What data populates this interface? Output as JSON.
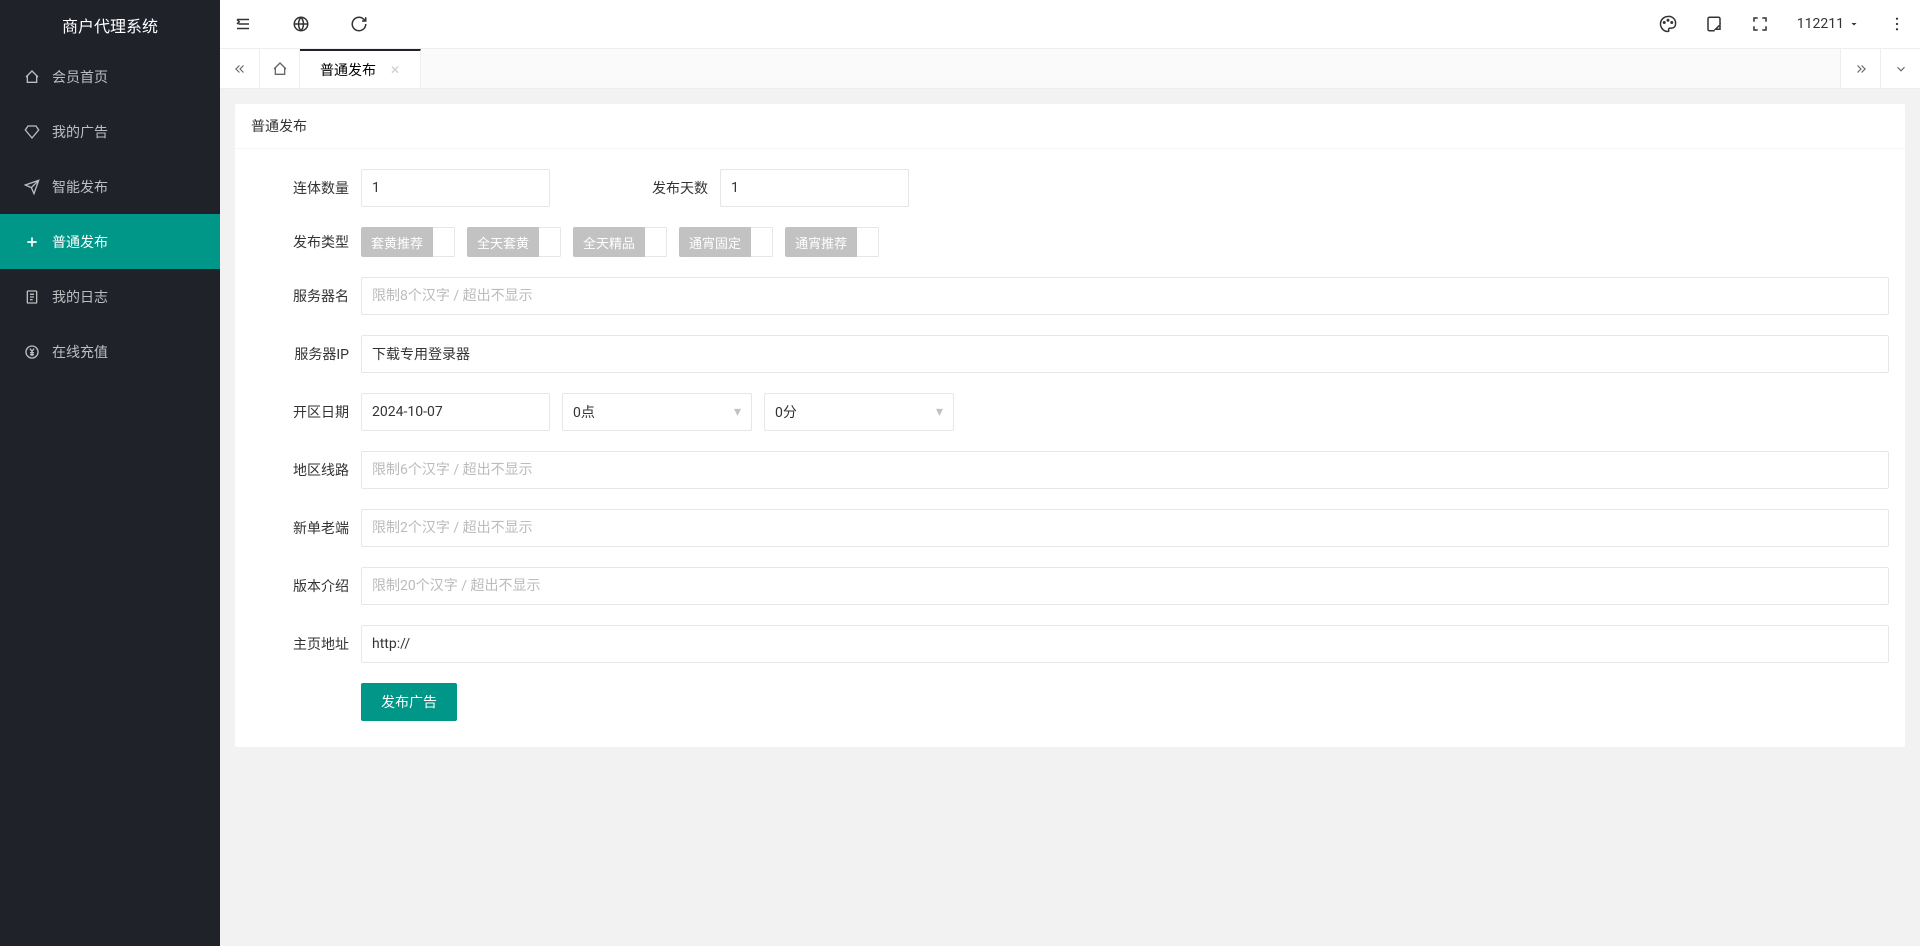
{
  "app": {
    "title": "商户代理系统"
  },
  "sidebar": {
    "items": [
      {
        "label": "会员首页"
      },
      {
        "label": "我的广告"
      },
      {
        "label": "智能发布"
      },
      {
        "label": "普通发布"
      },
      {
        "label": "我的日志"
      },
      {
        "label": "在线充值"
      }
    ]
  },
  "topbar": {
    "username": "112211"
  },
  "tabs": {
    "active": {
      "label": "普通发布"
    }
  },
  "card": {
    "title": "普通发布"
  },
  "form": {
    "qty_label": "连体数量",
    "qty_value": "1",
    "days_label": "发布天数",
    "days_value": "1",
    "type_label": "发布类型",
    "type_options": [
      "套黄推荐",
      "全天套黄",
      "全天精品",
      "通宵固定",
      "通宵推荐"
    ],
    "server_name_label": "服务器名",
    "server_name_placeholder": "限制8个汉字 / 超出不显示",
    "server_ip_label": "服务器IP",
    "server_ip_value": "下载专用登录器",
    "open_date_label": "开区日期",
    "open_date_value": "2024-10-07",
    "hour_value": "0点",
    "minute_value": "0分",
    "region_label": "地区线路",
    "region_placeholder": "限制6个汉字 / 超出不显示",
    "client_label": "新单老端",
    "client_placeholder": "限制2个汉字 / 超出不显示",
    "version_label": "版本介绍",
    "version_placeholder": "限制20个汉字 / 超出不显示",
    "homepage_label": "主页地址",
    "homepage_value": "http://",
    "submit_label": "发布广告"
  }
}
